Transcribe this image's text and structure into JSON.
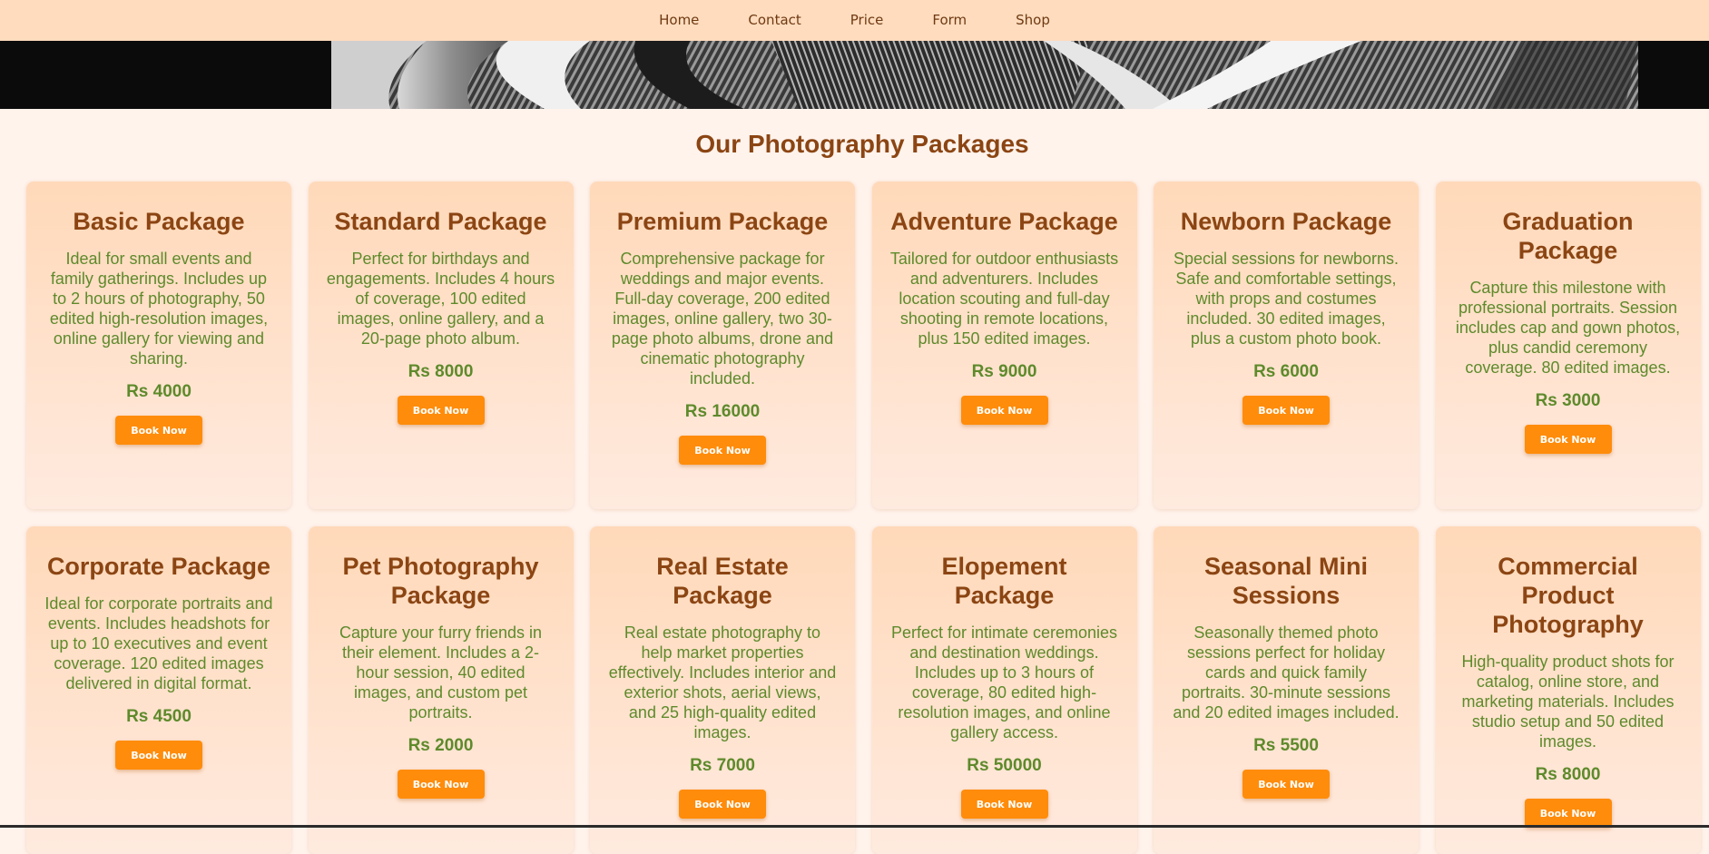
{
  "nav": {
    "items": [
      "Home",
      "Contact",
      "Price",
      "Form",
      "Shop"
    ]
  },
  "section": {
    "title": "Our Photography Packages"
  },
  "packages": [
    {
      "title": "Basic Package",
      "description": "Ideal for small events and family gatherings. Includes up to 2 hours of photography, 50 edited high-resolution images, online gallery for viewing and sharing.",
      "price": "Rs 4000",
      "button": "Book Now"
    },
    {
      "title": "Standard Package",
      "description": "Perfect for birthdays and engagements. Includes 4 hours of coverage, 100 edited images, online gallery, and a 20-page photo album.",
      "price": "Rs 8000",
      "button": "Book Now"
    },
    {
      "title": "Premium Package",
      "description": "Comprehensive package for weddings and major events. Full-day coverage, 200 edited images, online gallery, two 30-page photo albums, drone and cinematic photography included.",
      "price": "Rs 16000",
      "button": "Book Now"
    },
    {
      "title": "Adventure Package",
      "description": "Tailored for outdoor enthusiasts and adventurers. Includes location scouting and full-day shooting in remote locations, plus 150 edited images.",
      "price": "Rs 9000",
      "button": "Book Now"
    },
    {
      "title": "Newborn Package",
      "description": "Special sessions for newborns. Safe and comfortable settings, with props and costumes included. 30 edited images, plus a custom photo book.",
      "price": "Rs 6000",
      "button": "Book Now"
    },
    {
      "title": "Graduation Package",
      "description": "Capture this milestone with professional portraits. Session includes cap and gown photos, plus candid ceremony coverage. 80 edited images.",
      "price": "Rs 3000",
      "button": "Book Now"
    },
    {
      "title": "Corporate Package",
      "description": "Ideal for corporate portraits and events. Includes headshots for up to 10 executives and event coverage. 120 edited images delivered in digital format.",
      "price": "Rs 4500",
      "button": "Book Now"
    },
    {
      "title": "Pet Photography Package",
      "description": "Capture your furry friends in their element. Includes a 2-hour session, 40 edited images, and custom pet portraits.",
      "price": "Rs 2000",
      "button": "Book Now"
    },
    {
      "title": "Real Estate Package",
      "description": "Real estate photography to help market properties effectively. Includes interior and exterior shots, aerial views, and 25 high-quality edited images.",
      "price": "Rs 7000",
      "button": "Book Now"
    },
    {
      "title": "Elopement Package",
      "description": "Perfect for intimate ceremonies and destination weddings. Includes up to 3 hours of coverage, 80 edited high-resolution images, and online gallery access.",
      "price": "Rs 50000",
      "button": "Book Now"
    },
    {
      "title": "Seasonal Mini Sessions",
      "description": "Seasonally themed photo sessions perfect for holiday cards and quick family portraits. 30-minute sessions and 20 edited images included.",
      "price": "Rs 5500",
      "button": "Book Now"
    },
    {
      "title": "Commercial Product Photography",
      "description": "High-quality product shots for catalog, online store, and marketing materials. Includes studio setup and 50 edited images.",
      "price": "Rs 8000",
      "button": "Book Now"
    }
  ],
  "colors": {
    "nav_bg": "#ffdcbe",
    "page_bg": "#fff3ec",
    "heading": "#8b4513",
    "body_text": "#5e8a2b",
    "button": "#ff8c0a"
  }
}
